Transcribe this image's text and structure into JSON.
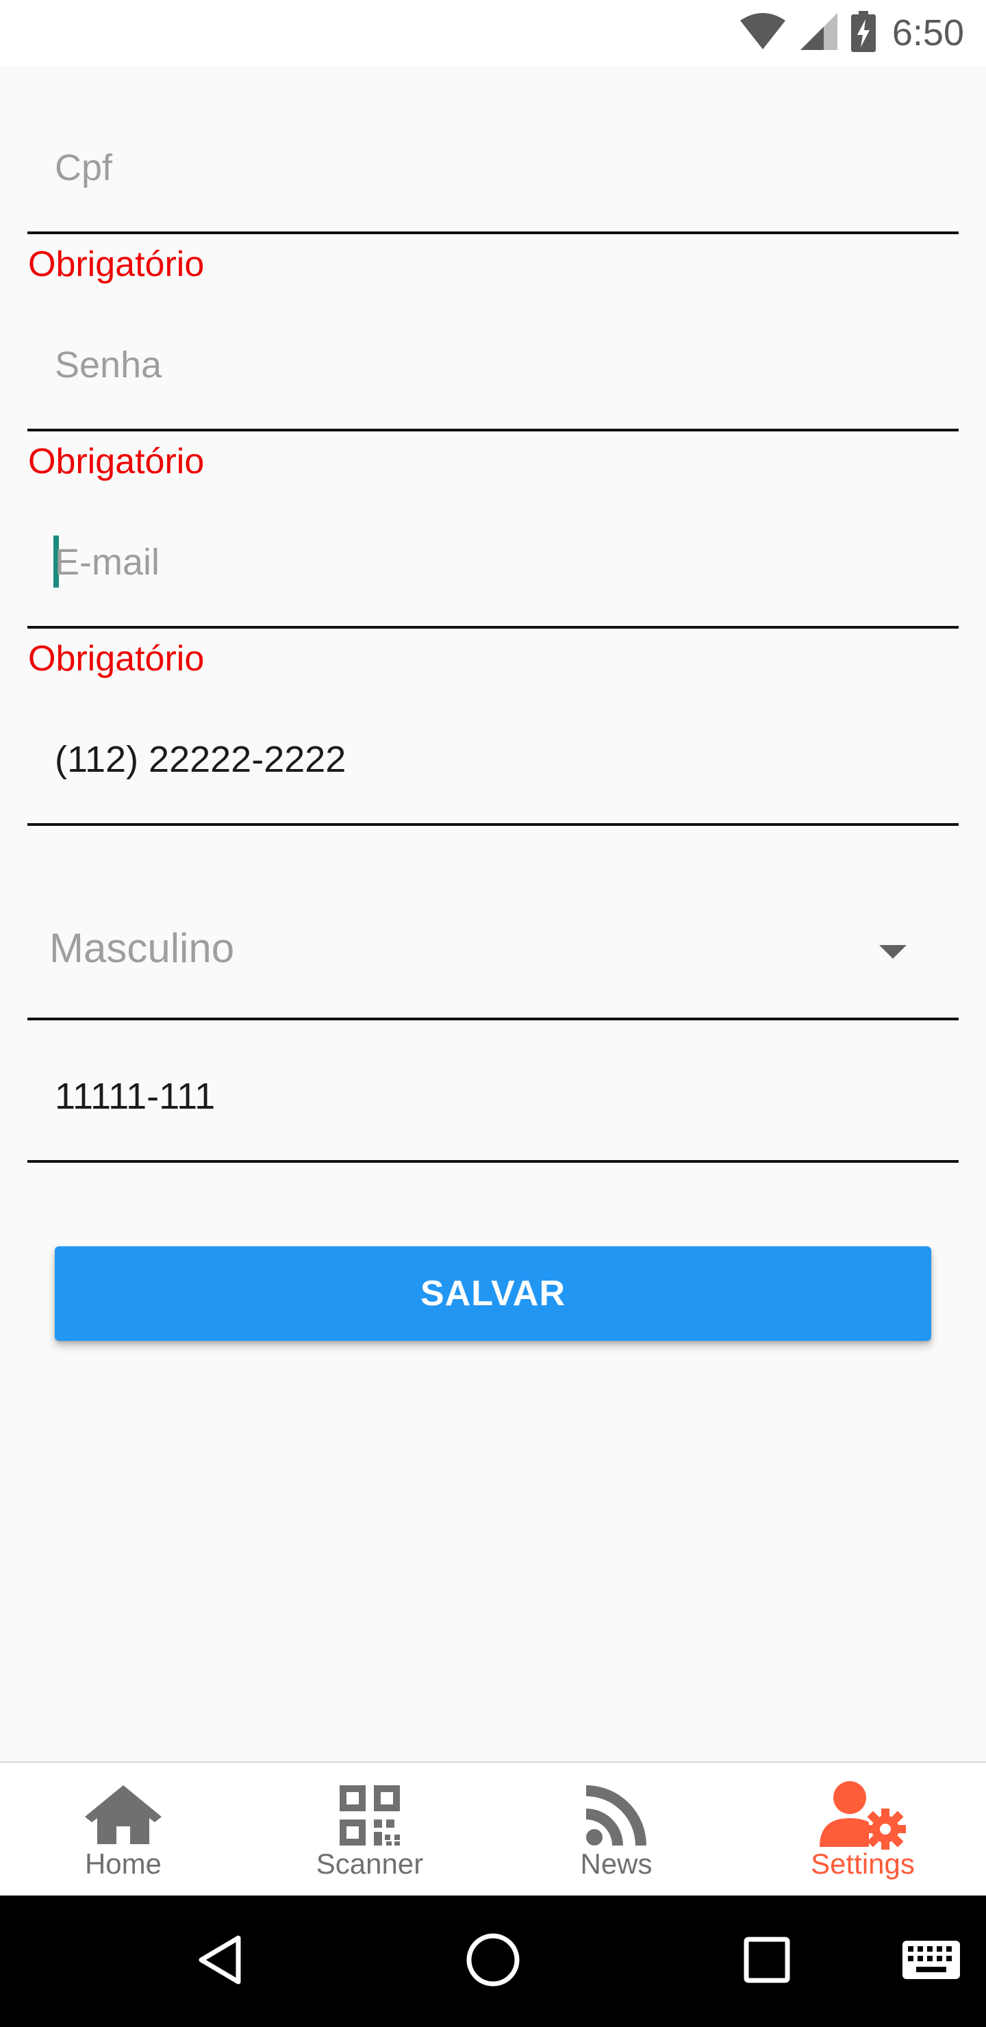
{
  "status_bar": {
    "time": "6:50",
    "icons": [
      "wifi-icon",
      "cell-signal-icon",
      "battery-charging-icon"
    ]
  },
  "form": {
    "cpf": {
      "placeholder": "Cpf",
      "value": "",
      "error": "Obrigatório"
    },
    "senha": {
      "placeholder": "Senha",
      "value": "",
      "error": "Obrigatório"
    },
    "email": {
      "placeholder": "E-mail",
      "value": "",
      "error": "Obrigatório"
    },
    "phone": {
      "value": "(112) 22222-2222"
    },
    "gender": {
      "selected": "Masculino"
    },
    "cep": {
      "value": "11111-111"
    },
    "save_label": "SALVAR"
  },
  "bottom_nav": {
    "items": [
      {
        "label": "Home",
        "icon": "home-icon",
        "active": false
      },
      {
        "label": "Scanner",
        "icon": "qr-code-icon",
        "active": false
      },
      {
        "label": "News",
        "icon": "rss-feed-icon",
        "active": false
      },
      {
        "label": "Settings",
        "icon": "user-settings-icon",
        "active": true
      }
    ]
  },
  "system_nav": {
    "icons": [
      "back-icon",
      "home-circle-icon",
      "recents-icon",
      "keyboard-icon"
    ]
  },
  "colors": {
    "background": "#fafafa",
    "error": "#ee0000",
    "primary_button": "#2196f3",
    "active_tab": "#ff5c3a",
    "inactive_tab": "#707070",
    "cursor": "#1b8b7a"
  }
}
